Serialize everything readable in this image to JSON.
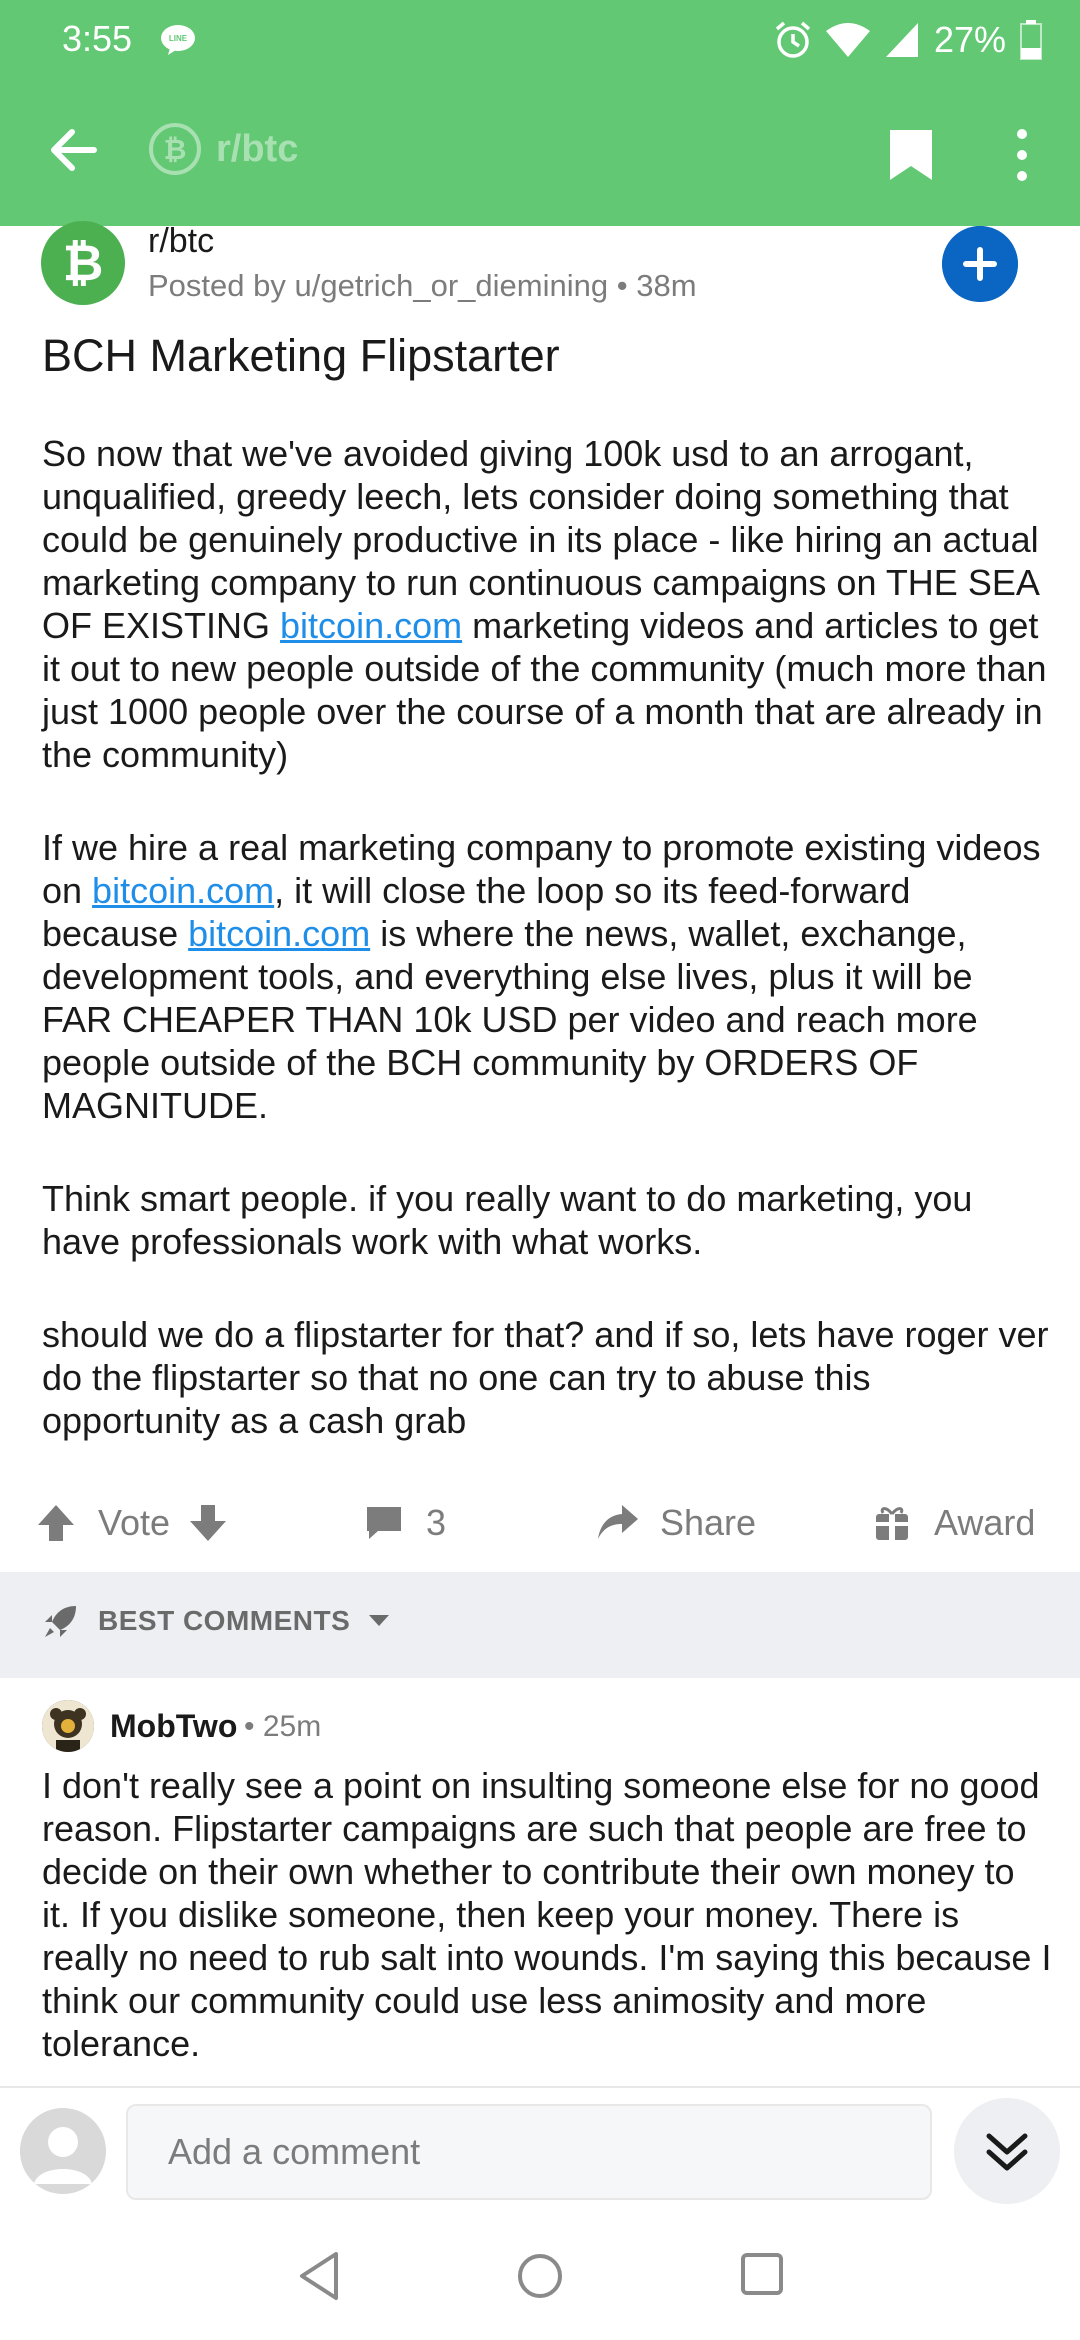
{
  "status": {
    "time": "3:55",
    "battery": "27%"
  },
  "toolbar": {
    "subreddit": "r/btc"
  },
  "post": {
    "subreddit": "r/btc",
    "author": "Posted by u/getrich_or_diemining",
    "age": "38m",
    "title": "BCH Marketing Flipstarter",
    "p1a": "So now that we've avoided giving 100k usd to an arrogant, unqualified, greedy leech, lets consider doing something that could be genuinely productive in its place - like hiring an actual marketing company to run continuous campaigns on THE SEA OF EXISTING ",
    "p1link": "bitcoin.com",
    "p1b": " marketing videos and articles to get it out to new people outside of the community (much more than just 1000 people over the course of a month that are already in the community)",
    "p2a": "If we hire a real marketing company to promote existing videos on ",
    "p2link1": "bitcoin.com",
    "p2b": ", it will close the loop so its feed-forward because ",
    "p2link2": "bitcoin.com",
    "p2c": " is where the news, wallet, exchange, development tools, and everything else lives, plus it will be FAR CHEAPER THAN 10k USD per video and reach more people outside of the BCH community by ORDERS OF MAGNITUDE.",
    "p3": "Think smart people. if you really want to do marketing, you have professionals work with what works.",
    "p4": "should we do a flipstarter for that? and if so, lets have roger ver do the flipstarter so that no one can try to abuse this opportunity as a cash grab"
  },
  "actions": {
    "vote": "Vote",
    "comments": "3",
    "share": "Share",
    "award": "Award"
  },
  "comments_header": {
    "sort_label": "BEST COMMENTS"
  },
  "comment": {
    "author": "MobTwo",
    "age": "• 25m",
    "body": "I don't really see a point on insulting someone else for no good reason. Flipstarter campaigns are such that people are free to decide on their own whether to contribute their own money to it. If you dislike someone, then keep your money. There is really no need to rub salt into wounds. I'm saying this because I think our community could use less animosity and more tolerance."
  },
  "comment_bar": {
    "placeholder": "Add a comment"
  },
  "colors": {
    "appbar": "#62c874",
    "link": "#1f8ee8",
    "join_button": "#0a66c2",
    "bitcoin_badge": "#4caf50"
  }
}
